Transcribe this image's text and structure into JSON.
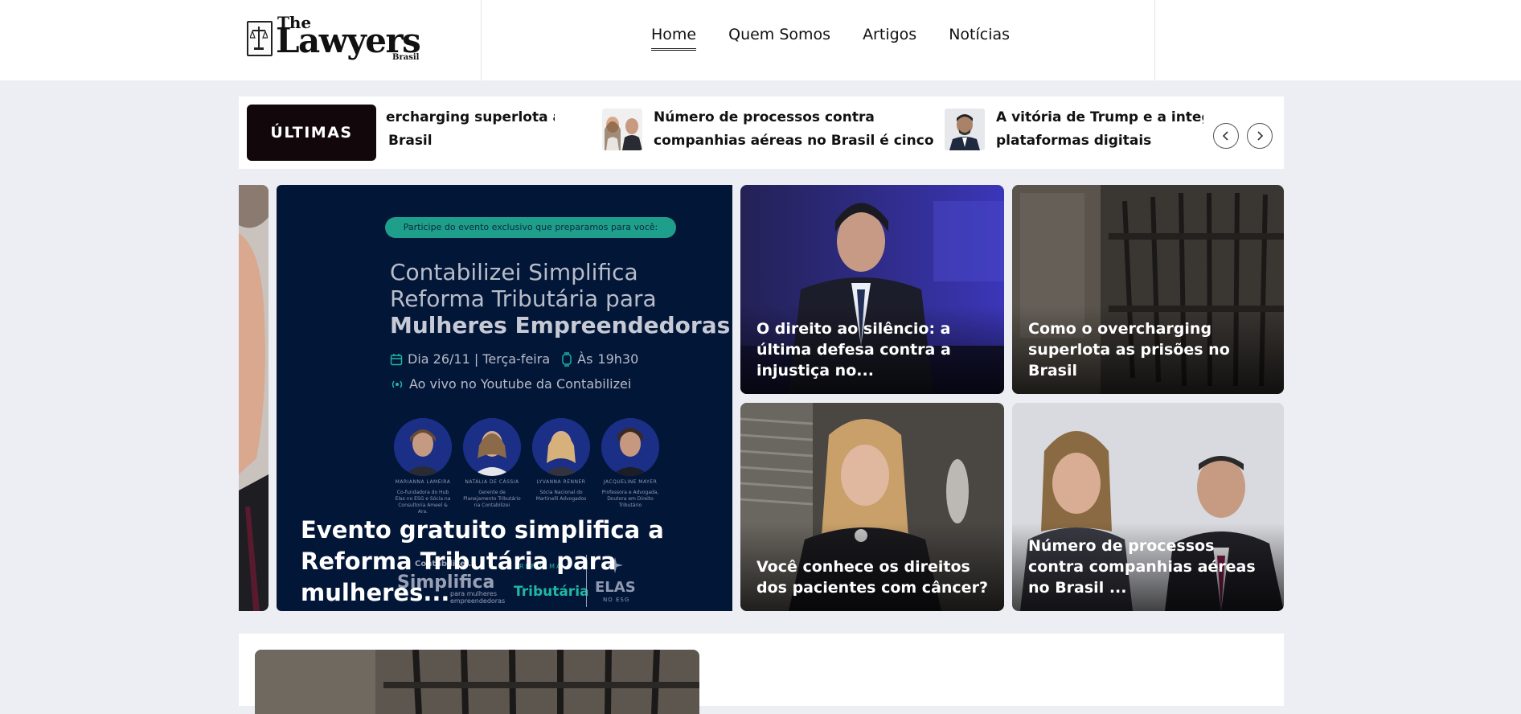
{
  "brand": {
    "logo_the": "The",
    "logo_main": "Lawyers",
    "logo_sub": "Brasil"
  },
  "nav": {
    "items": [
      {
        "label": "Home",
        "active": true
      },
      {
        "label": "Quem Somos"
      },
      {
        "label": "Artigos"
      },
      {
        "label": "Notícias"
      }
    ]
  },
  "ticker": {
    "label": "ÚLTIMAS",
    "items": [
      {
        "title_line1": "ercharging superlota as",
        "title_line2": "Brasil"
      },
      {
        "title_line1": "Número de processos contra",
        "title_line2": "companhias aéreas no Brasil é cinco ..."
      },
      {
        "title_line1": "A vitória de Trump e a integrid",
        "title_line2": "plataformas digitais"
      }
    ]
  },
  "hero": {
    "event_pill": "Participe do evento exclusivo que preparamos para você:",
    "event_line1": "Contabilizei Simplifica",
    "event_line2": "Reforma Tributária para",
    "event_line3": "Mulheres Empreendedoras",
    "event_dot": ".",
    "event_date": "Dia 26/11 | Terça-feira",
    "event_time_label": "Às",
    "event_time": "19h30",
    "event_live": "Ao vivo no Youtube da Contabilizei",
    "speakers": [
      {
        "name": "MARIANNA LAMEIRA",
        "role": "Co-fundadora do Hub Elas no ESG e Sócia na Consultoria Ameel & Ara."
      },
      {
        "name": "NATÁLIA DE CÁSSIA",
        "role": "Gerente de Planejamento Tributário na Contabilizei"
      },
      {
        "name": "LYVANNA RENNER",
        "role": "Sócia Nacional do Martinelli Advogados"
      },
      {
        "name": "JACQUELINE MAYER",
        "role": "Professora e Advogada, Doutora em Direito Tributário"
      }
    ],
    "logo_contabilizei": "Contabilizei.",
    "logo_simplifica": "Simplifica",
    "logo_reforma": "REFORMA",
    "logo_tributaria": "Tributária",
    "logo_mulheres": "para mulheres empreendedoras",
    "logo_elas": "ELAS",
    "logo_noesg": "NO ESG",
    "title": "Evento gratuito simplifica a Reforma Tributária para mulheres..."
  },
  "cards": [
    {
      "title": "O direito ao silêncio: a última defesa contra a injustiça no..."
    },
    {
      "title": "Como o overcharging superlota as prisões no Brasil"
    },
    {
      "title": "Você conhece os direitos dos pacientes com câncer?"
    },
    {
      "title": "Número de processos contra companhias aéreas no Brasil ..."
    }
  ],
  "colors": {
    "page_bg": "#eceef3",
    "ticker_label_bg": "#12070a",
    "hero_bg": "#021638",
    "event_accent": "#1e9f8c"
  }
}
